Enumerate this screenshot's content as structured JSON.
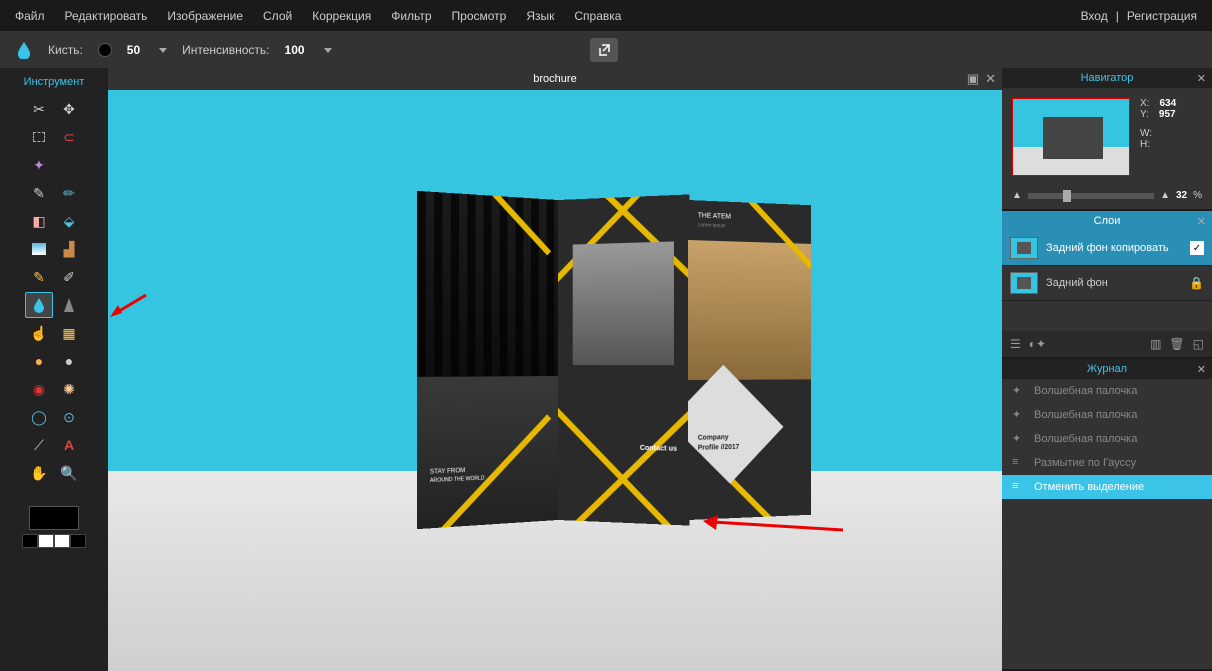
{
  "menu": {
    "items": [
      "Файл",
      "Редактировать",
      "Изображение",
      "Слой",
      "Коррекция",
      "Фильтр",
      "Просмотр",
      "Язык",
      "Справка"
    ],
    "login": "Вход",
    "sep": "|",
    "register": "Регистрация"
  },
  "options": {
    "brush_label": "Кисть:",
    "brush_value": "50",
    "intensity_label": "Интенсивность:",
    "intensity_value": "100"
  },
  "tools": {
    "title": "Инструмент",
    "names": [
      "crop",
      "move",
      "marquee",
      "lasso",
      "wand",
      "",
      "pencil",
      "brush",
      "eraser",
      "bucket",
      "gradient",
      "stamp",
      "colorreplace",
      "draw",
      "blur",
      "sharpen",
      "smudge",
      "sponge",
      "dodge",
      "burn",
      "redeye",
      "spot",
      "bloat",
      "pinch",
      "picker",
      "text",
      "hand",
      "zoom"
    ]
  },
  "canvas": {
    "title": "brochure",
    "brochure": {
      "header1": "THE ATEM",
      "header2": "Lorem ipsum",
      "contact": "Contact us",
      "company": "Company",
      "profile": "Profile //2017",
      "tag1": "STAY FROM",
      "tag2": "AROUND THE WORLD"
    }
  },
  "navigator": {
    "title": "Навигатор",
    "x_label": "X:",
    "x_value": "634",
    "y_label": "Y:",
    "y_value": "957",
    "w_label": "W:",
    "h_label": "H:",
    "zoom": "32",
    "zoom_unit": "%"
  },
  "layers": {
    "title": "Слои",
    "items": [
      {
        "name": "Задний фон копировать",
        "selected": true,
        "visible_check": true
      },
      {
        "name": "Задний фон",
        "selected": false,
        "locked": true
      }
    ]
  },
  "history": {
    "title": "Журнал",
    "items": [
      {
        "label": "Волшебная палочка",
        "active": false
      },
      {
        "label": "Волшебная палочка",
        "active": false
      },
      {
        "label": "Волшебная палочка",
        "active": false
      },
      {
        "label": "Размытие по Гауссу",
        "active": false
      },
      {
        "label": "Отменить выделение",
        "active": true
      }
    ]
  }
}
